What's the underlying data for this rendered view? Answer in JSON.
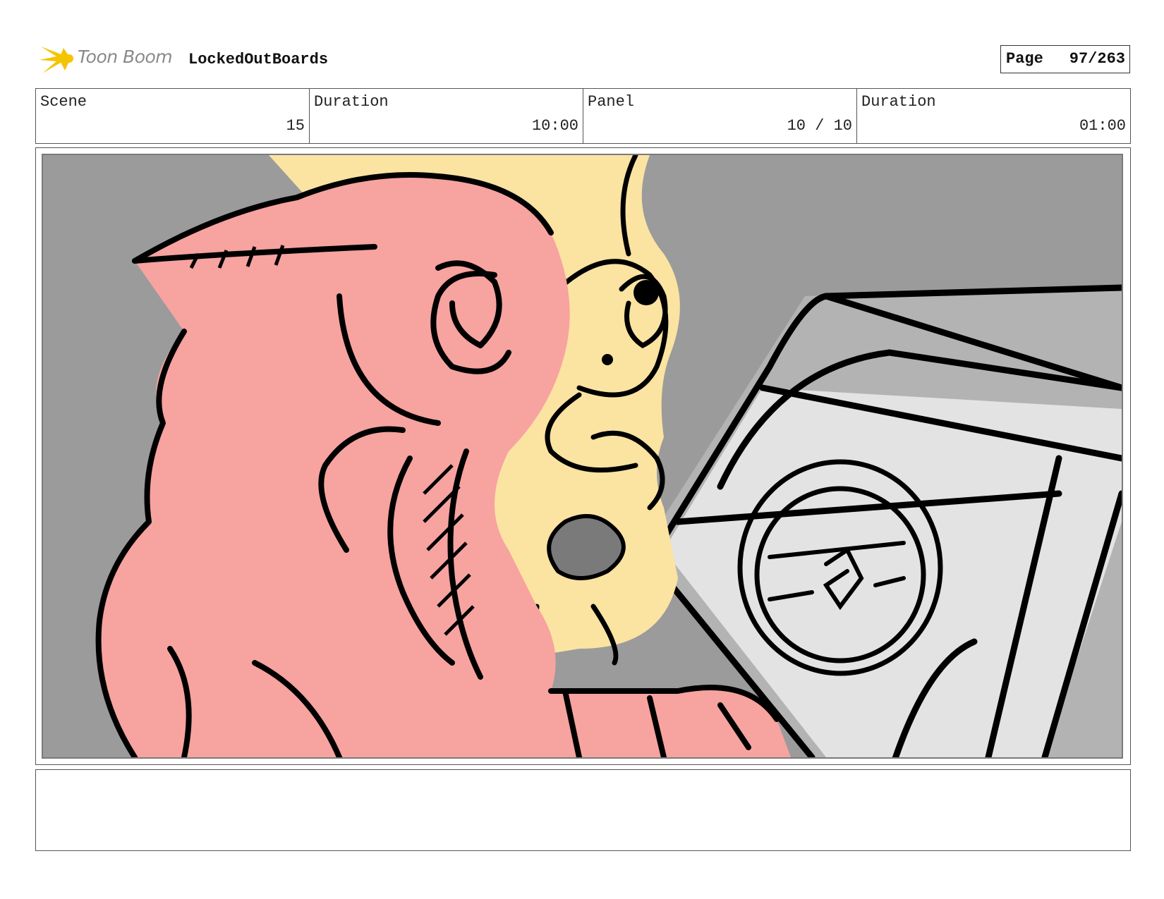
{
  "header": {
    "logo_text": "Toon Boom",
    "project": "LockedOutBoards",
    "page_label": "Page",
    "page_value": "97/263"
  },
  "info": [
    {
      "label": "Scene",
      "value": "15"
    },
    {
      "label": "Duration",
      "value": "10:00"
    },
    {
      "label": "Panel",
      "value": "10 / 10"
    },
    {
      "label": "Duration",
      "value": "01:00"
    }
  ],
  "colors": {
    "background_gray": "#9b9b9b",
    "pink": "#f7a3a0",
    "yellow": "#fbe3a2",
    "light_gray": "#e3e3e3",
    "mid_gray": "#b3b3b3",
    "logo_yellow": "#f5c400"
  },
  "notes": ""
}
